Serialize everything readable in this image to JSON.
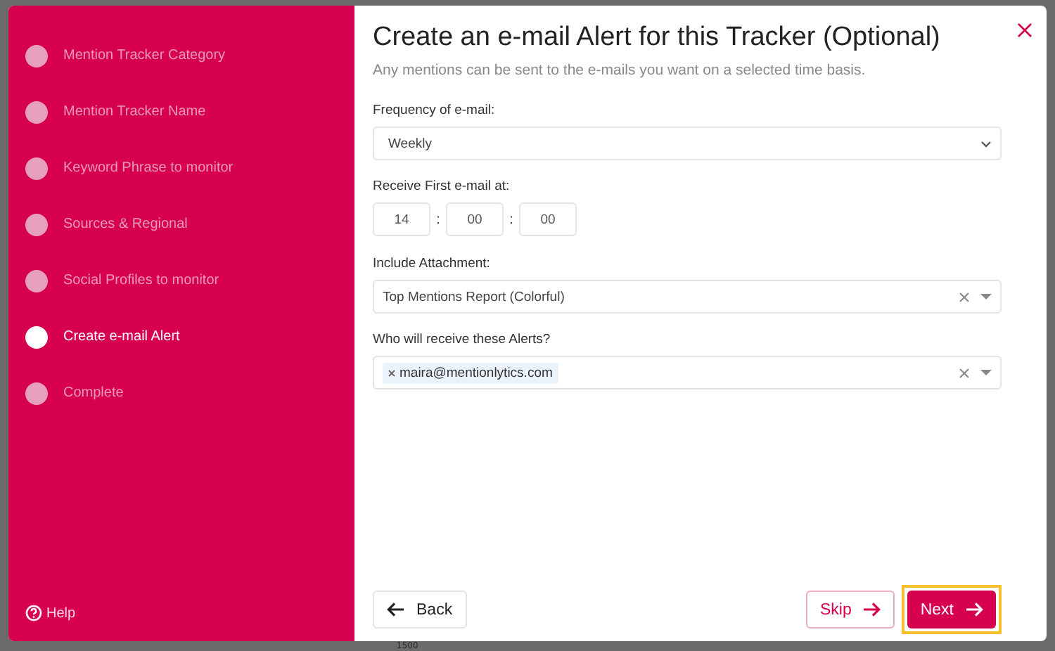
{
  "background": {
    "axis_label": "1500"
  },
  "steps": [
    {
      "label": "Mention Tracker Category",
      "selected": false
    },
    {
      "label": "Mention Tracker Name",
      "selected": false
    },
    {
      "label": "Keyword Phrase to monitor",
      "selected": false
    },
    {
      "label": "Sources & Regional",
      "selected": false
    },
    {
      "label": "Social Profiles to monitor",
      "selected": false
    },
    {
      "label": "Create e-mail Alert",
      "selected": true
    },
    {
      "label": "Complete",
      "selected": false
    }
  ],
  "help": "Help",
  "title": "Create an e-mail Alert for this Tracker (Optional)",
  "subtitle": "Any mentions can be sent to the e-mails you want on a selected time basis.",
  "frequency": {
    "label": "Frequency of e-mail:",
    "value": "Weekly"
  },
  "time": {
    "label": "Receive First e-mail at:",
    "parts": [
      "14",
      "00",
      "00"
    ],
    "separator": ":"
  },
  "attachment": {
    "label": "Include Attachment:",
    "value": "Top Mentions Report (Colorful)"
  },
  "recipients": {
    "label": "Who will receive these Alerts?",
    "tags": [
      "maira@mentionlytics.com"
    ]
  },
  "buttons": {
    "back": "Back",
    "skip": "Skip",
    "next": "Next",
    "next_highlighted": true
  }
}
